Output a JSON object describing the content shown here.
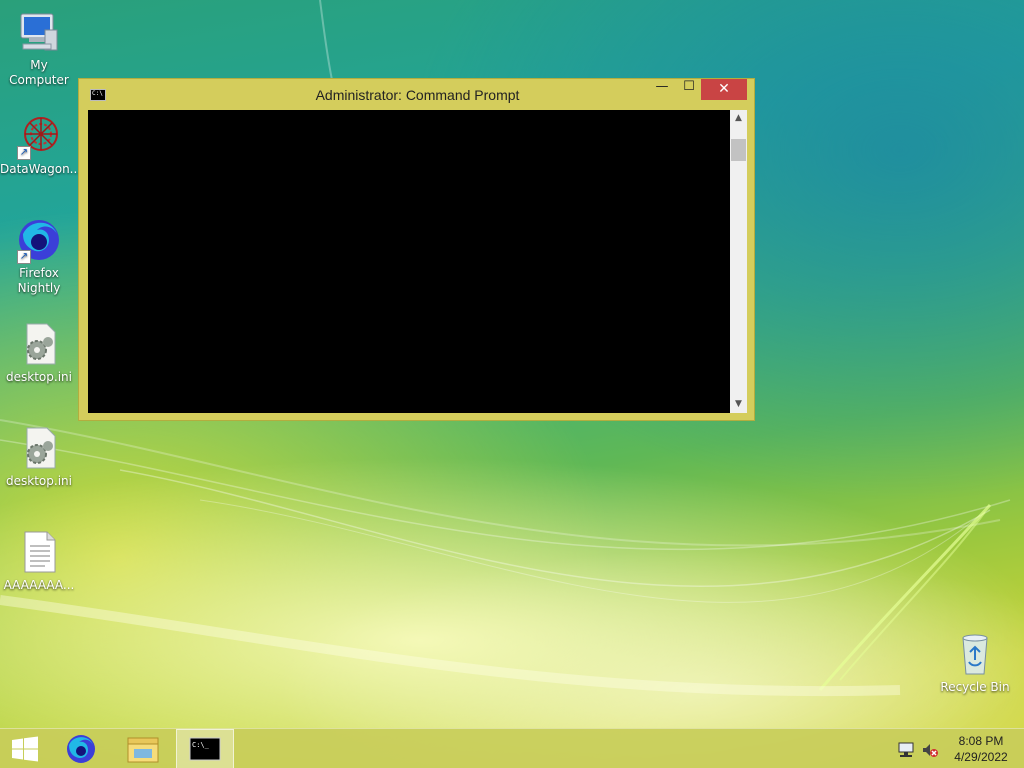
{
  "desktop": {
    "icons": [
      {
        "label": "My Computer",
        "icon": "computer-icon"
      },
      {
        "label": "DataWagon...",
        "icon": "datawagon-icon"
      },
      {
        "label": "Firefox Nightly",
        "icon": "firefox-nightly-icon"
      },
      {
        "label": "desktop.ini",
        "icon": "settings-file-icon"
      },
      {
        "label": "desktop.ini",
        "icon": "settings-file-icon"
      },
      {
        "label": "AAAAAAA...",
        "icon": "text-file-icon"
      },
      {
        "label": "Recycle Bin",
        "icon": "recycle-bin-icon"
      }
    ]
  },
  "window": {
    "title": "Administrator: Command Prompt",
    "icon": "cmd-icon",
    "minimize_label": "—",
    "maximize_label": "☐",
    "close_label": "✕",
    "frame_color": "#d4cd5c",
    "close_color": "#c94444",
    "console_text": ""
  },
  "taskbar": {
    "start_icon": "windows-logo-icon",
    "pinned": [
      {
        "name": "firefox-nightly-icon"
      },
      {
        "name": "file-explorer-icon"
      },
      {
        "name": "cmd-icon",
        "active": true
      }
    ],
    "tray": {
      "network_icon": "network-icon",
      "volume_icon": "volume-muted-icon"
    },
    "clock": {
      "time": "8:08 PM",
      "date": "4/29/2022"
    }
  }
}
